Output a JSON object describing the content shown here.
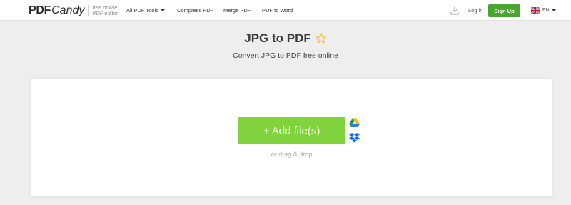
{
  "header": {
    "logo": {
      "pdf": "PDF",
      "candy": "Candy",
      "tagline_1": "free online",
      "tagline_2": "PDF editor"
    },
    "nav": [
      {
        "label": "All PDF Tools",
        "has_caret": true
      },
      {
        "label": "Compress PDF"
      },
      {
        "label": "Merge PDF"
      },
      {
        "label": "PDF to Word"
      }
    ],
    "login_label": "Log in",
    "signup_label": "Sign Up",
    "language": "EN"
  },
  "main": {
    "title": "JPG to PDF",
    "subtitle": "Convert JPG to PDF free online",
    "add_files_label": "+ Add file(s)",
    "drag_drop_label": "or drag & drop"
  },
  "colors": {
    "signup_bg": "#47a530",
    "add_button_bg": "#80d33c",
    "star": "#f2c21a",
    "page_bg": "#eeeeee"
  }
}
